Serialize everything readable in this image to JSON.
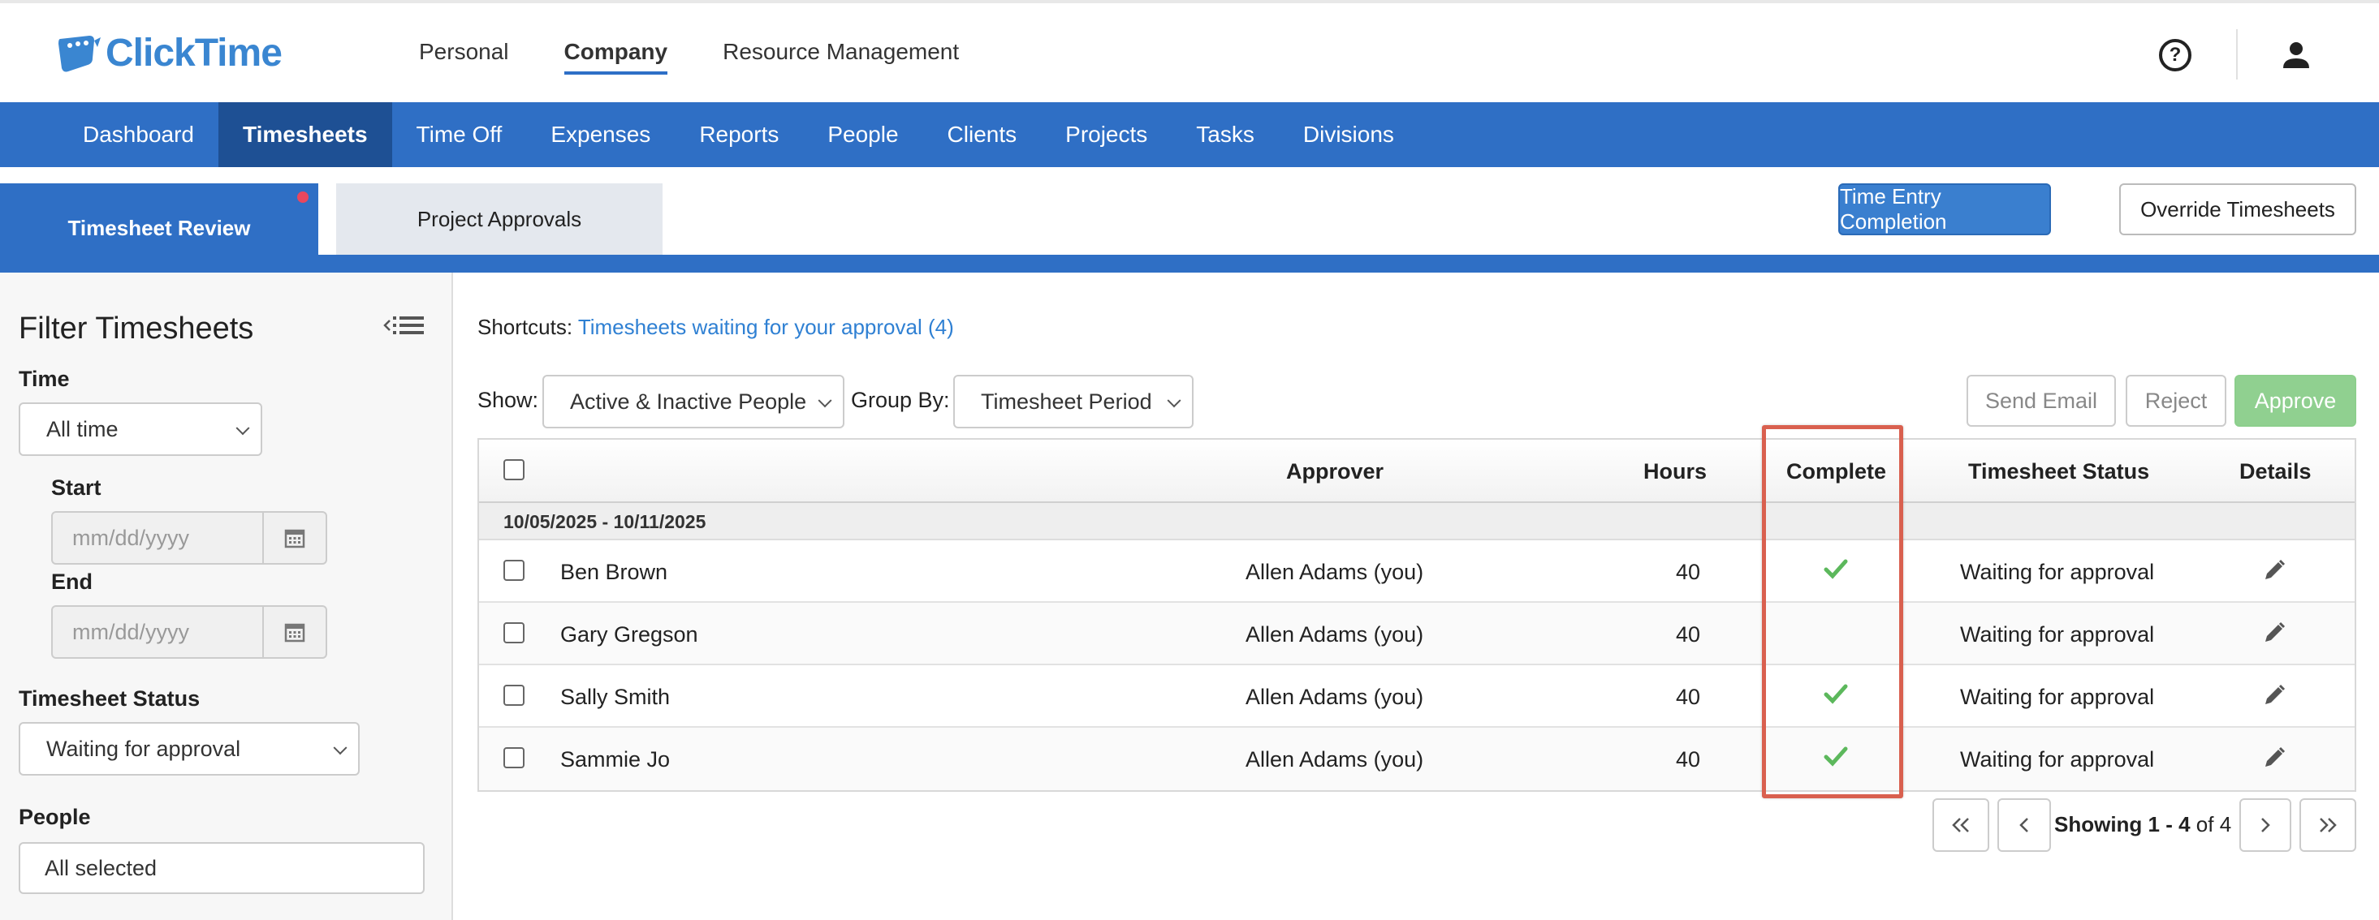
{
  "app": {
    "logo_text": "ClickTime"
  },
  "top_nav": {
    "items": [
      "Personal",
      "Company",
      "Resource Management"
    ],
    "active": "Company"
  },
  "main_nav": {
    "items": [
      "Dashboard",
      "Timesheets",
      "Time Off",
      "Expenses",
      "Reports",
      "People",
      "Clients",
      "Projects",
      "Tasks",
      "Divisions"
    ],
    "active": "Timesheets"
  },
  "sub_tabs": {
    "timesheet_review": "Timesheet Review",
    "project_approvals": "Project Approvals"
  },
  "header_buttons": {
    "time_entry_completion": "Time Entry Completion",
    "override_timesheets": "Override Timesheets"
  },
  "filter": {
    "title": "Filter Timesheets",
    "time_label": "Time",
    "time_value": "All time",
    "start_label": "Start",
    "start_placeholder": "mm/dd/yyyy",
    "end_label": "End",
    "end_placeholder": "mm/dd/yyyy",
    "status_label": "Timesheet Status",
    "status_value": "Waiting for approval",
    "people_label": "People",
    "people_value": "All selected"
  },
  "shortcuts": {
    "label": "Shortcuts:",
    "link": "Timesheets waiting for your approval (4)"
  },
  "controls": {
    "show_label": "Show:",
    "show_value": "Active & Inactive People",
    "group_label": "Group By:",
    "group_value": "Timesheet Period",
    "send_email": "Send Email",
    "reject": "Reject",
    "approve": "Approve"
  },
  "table": {
    "headers": {
      "approver": "Approver",
      "hours": "Hours",
      "complete": "Complete",
      "status": "Timesheet Status",
      "details": "Details"
    },
    "group": "10/05/2025 - 10/11/2025",
    "rows": [
      {
        "name": "Ben Brown",
        "approver": "Allen Adams (you)",
        "hours": "40",
        "complete": true,
        "status": "Waiting for approval"
      },
      {
        "name": "Gary Gregson",
        "approver": "Allen Adams (you)",
        "hours": "40",
        "complete": false,
        "status": "Waiting for approval"
      },
      {
        "name": "Sally Smith",
        "approver": "Allen Adams (you)",
        "hours": "40",
        "complete": true,
        "status": "Waiting for approval"
      },
      {
        "name": "Sammie Jo",
        "approver": "Allen Adams (you)",
        "hours": "40",
        "complete": true,
        "status": "Waiting for approval"
      }
    ]
  },
  "pagination": {
    "prefix": "Showing ",
    "range": "1 - 4",
    "of_text": " of 4"
  },
  "colors": {
    "brand_blue": "#2f6fc5",
    "check_green": "#5cb85c",
    "highlight_red": "#d9604f"
  }
}
